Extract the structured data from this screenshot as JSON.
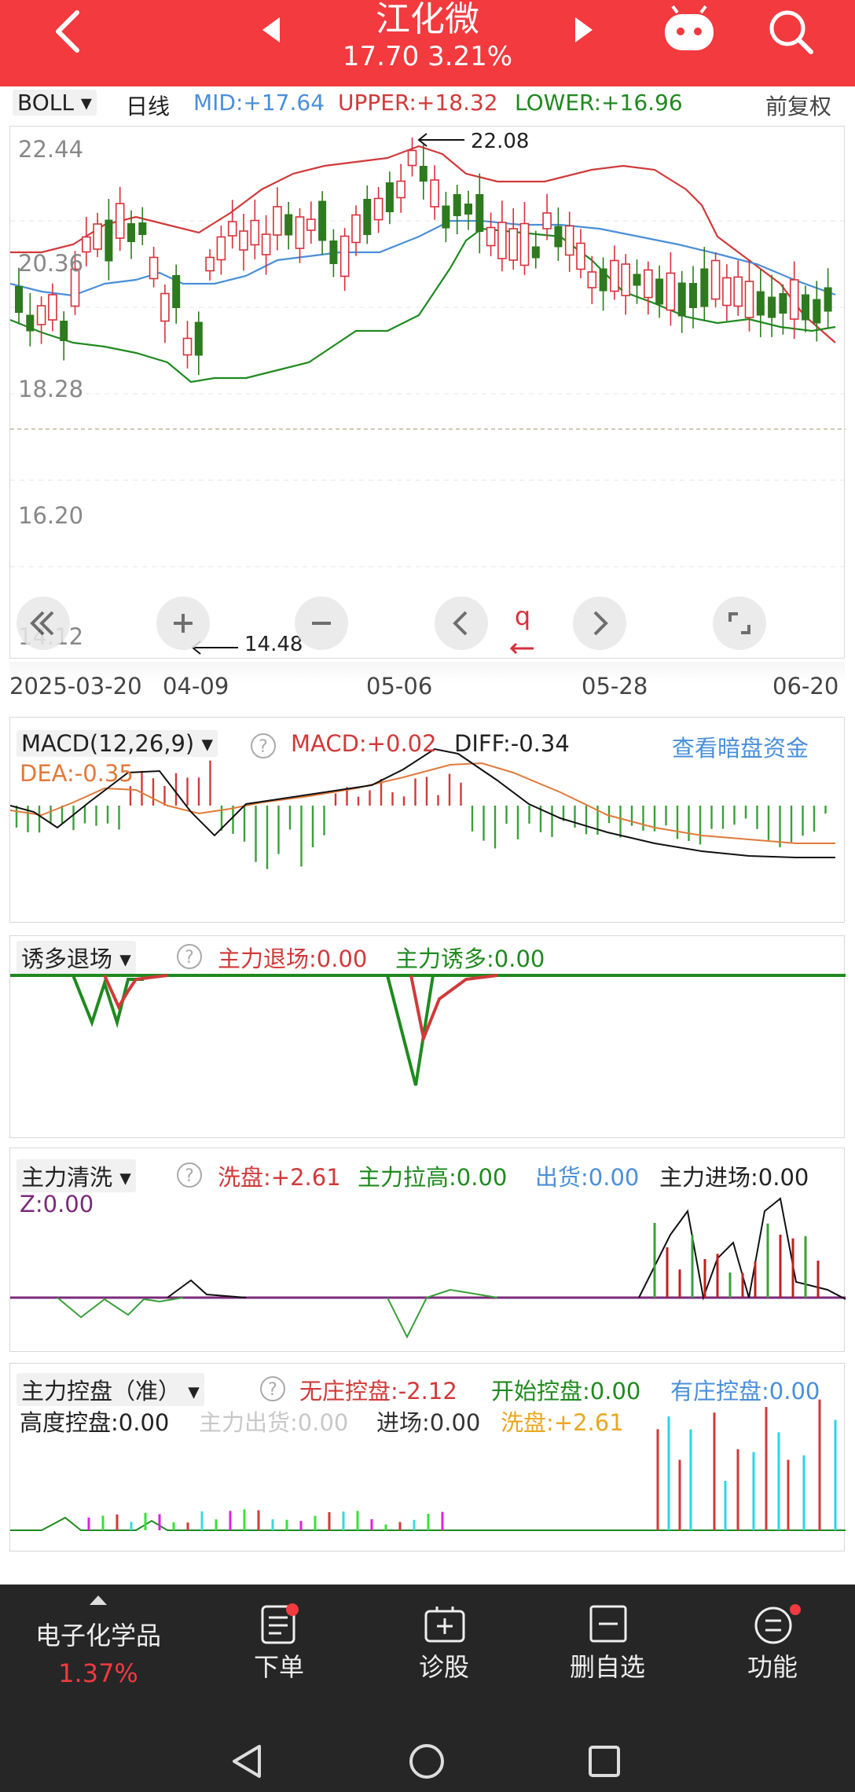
{
  "header": {
    "title": "江化微",
    "price": "17.70",
    "change_pct": "3.21%",
    "price_line": "17.70 3.21%"
  },
  "indicator_bar": {
    "indicator": "BOLL",
    "period": "日线",
    "mid": "MID:+17.64",
    "upper": "UPPER:+18.32",
    "lower": "LOWER:+16.96",
    "adjust": "前复权"
  },
  "price_chart": {
    "y_ticks": [
      "22.44",
      "20.36",
      "18.28",
      "16.20",
      "14.12"
    ],
    "high_label": "22.08",
    "low_label": "14.48",
    "dates": [
      "2025-03-20",
      "04-09",
      "05-06",
      "05-28",
      "06-20"
    ],
    "controls": {
      "q_label": "q"
    }
  },
  "macd_panel": {
    "title": "MACD(12,26,9)",
    "macd": "MACD:+0.02",
    "diff": "DIFF:-0.34",
    "dea": "DEA:-0.35",
    "link": "查看暗盘资金"
  },
  "lure_panel": {
    "title": "诱多退场",
    "exit": "主力退场:0.00",
    "lure": "主力诱多:0.00"
  },
  "wash_panel": {
    "title": "主力清洗",
    "wash": "洗盘:+2.61",
    "raise": "主力拉高:0.00",
    "ship": "出货:0.00",
    "enter": "主力进场:0.00",
    "z": "Z:0.00"
  },
  "control_panel": {
    "title": "主力控盘（准）",
    "no_control": "无庄控盘:-2.12",
    "start_control": "开始控盘:0.00",
    "has_control": "有庄控盘:0.00",
    "high_control": "高度控盘:0.00",
    "main_out": "主力出货:0.00",
    "entry": "进场:0.00",
    "wash": "洗盘:+2.61"
  },
  "bottom_nav": {
    "sector": "电子化学品",
    "sector_pct": "1.37%",
    "items": [
      {
        "label": "下单"
      },
      {
        "label": "诊股"
      },
      {
        "label": "删自选"
      },
      {
        "label": "功能"
      }
    ]
  },
  "colors": {
    "red": "#f23a3f",
    "green": "#1f8a1f",
    "blue": "#4a8fd8",
    "orange": "#e07a3a",
    "up_candle": "#d8303a",
    "down_candle": "#2e7a1e"
  }
}
